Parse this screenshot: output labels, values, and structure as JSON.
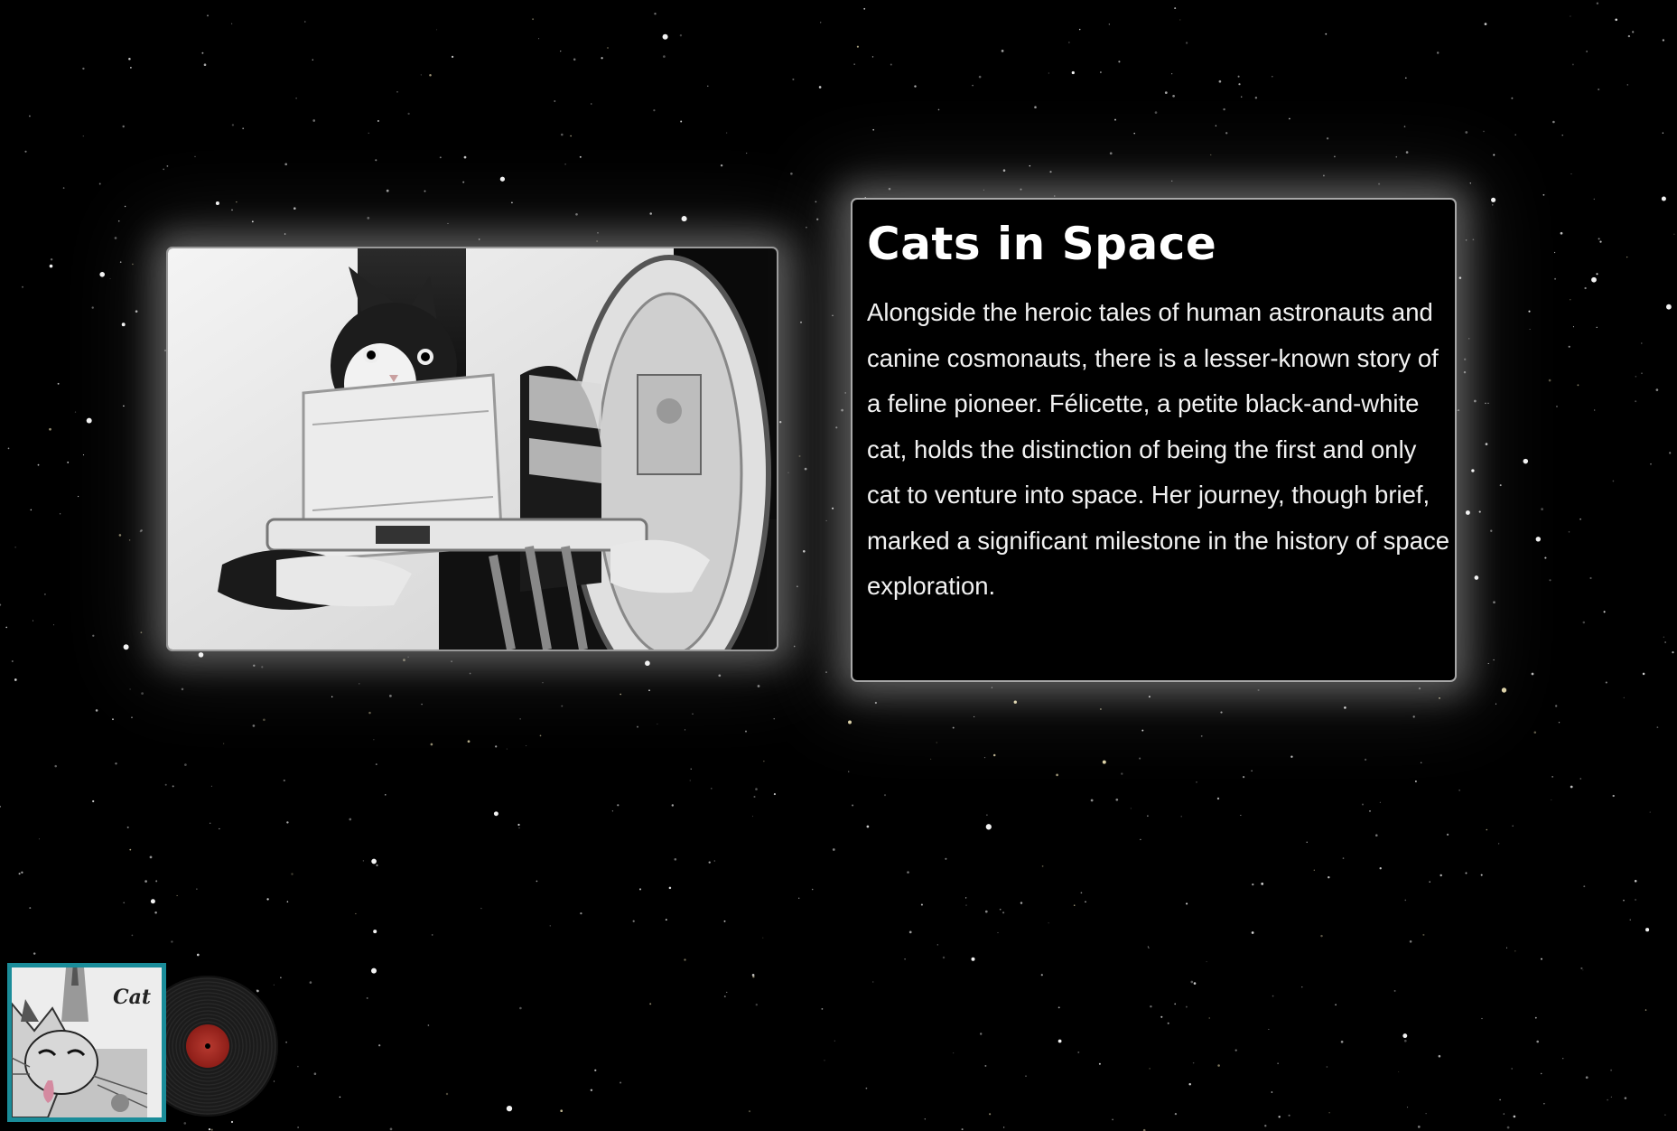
{
  "article": {
    "title": "Cats in Space",
    "body": "Alongside the heroic tales of human astronauts and canine cosmonauts, there is a lesser-known story of a feline pioneer. Félicette, a petite black-and-white cat, holds the distinction of being the first and only cat to venture into space. Her journey, though brief, marked a significant milestone in the history of space exploration."
  },
  "photo": {
    "icon": "cat-in-harness-photo"
  },
  "music_player": {
    "album_title": "Cat",
    "album_icon": "album-cover-art",
    "record_icon": "vinyl-record-icon",
    "accent_color": "#1a8c99",
    "label_color": "#8e1e18"
  },
  "theme": {
    "background": "#000000",
    "card_border": "#a8a8a8",
    "text": "#ffffff"
  }
}
